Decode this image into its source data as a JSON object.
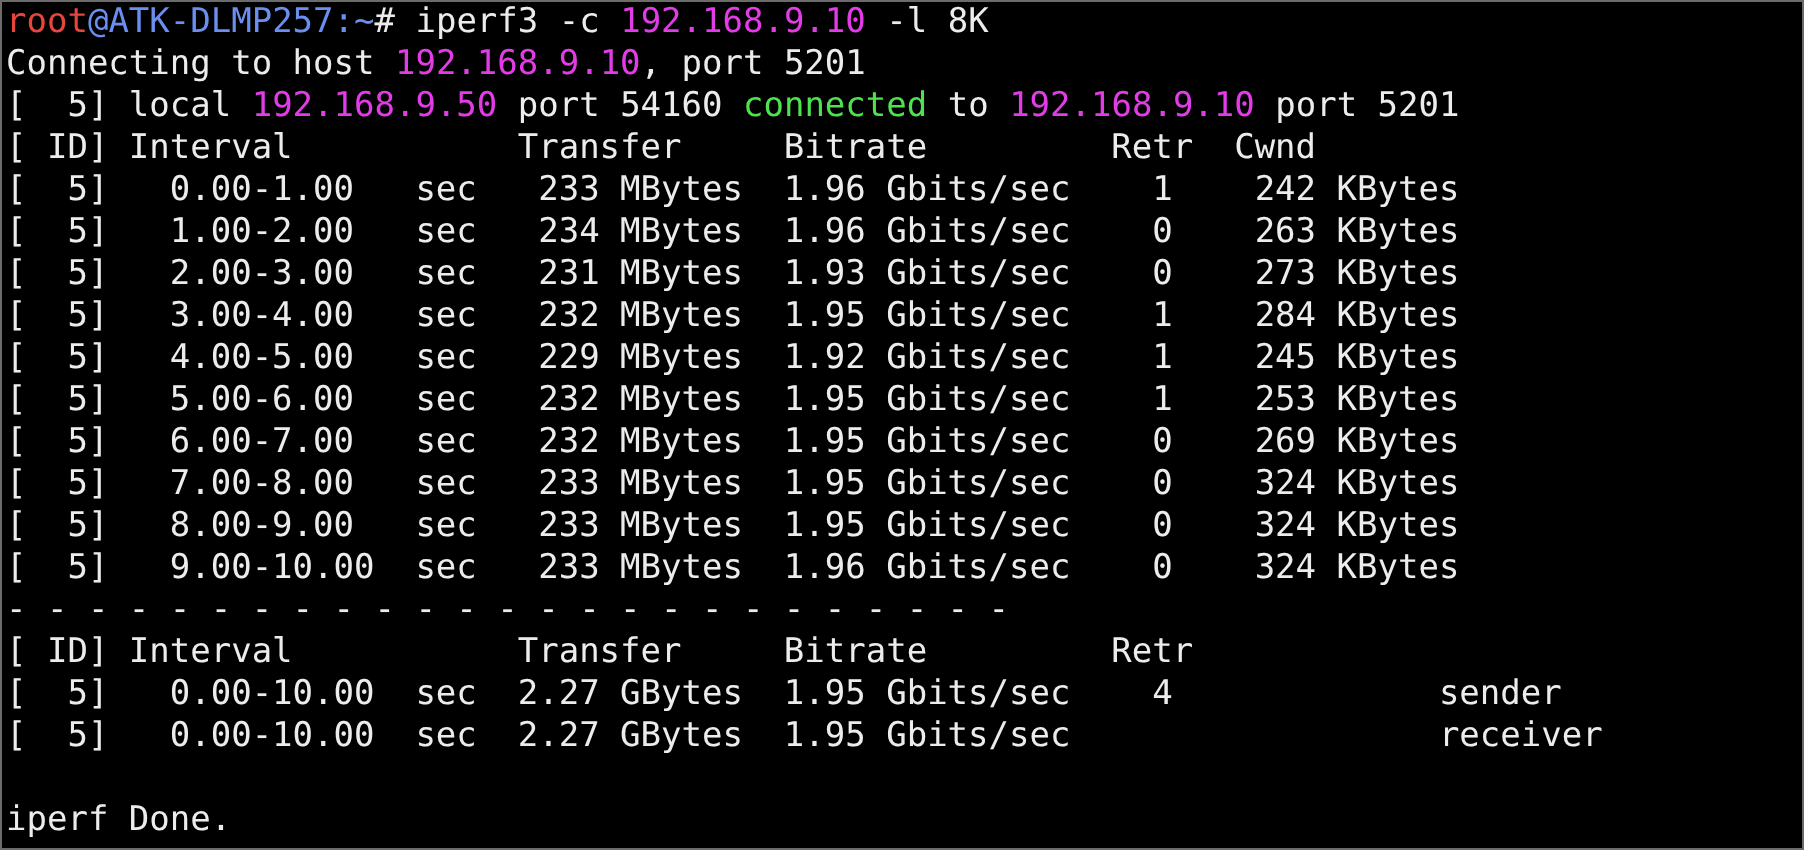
{
  "terminal": {
    "lines": [
      {
        "kind": "text",
        "segments": [
          {
            "text": "root",
            "color": "#e8453c"
          },
          {
            "text": "@ATK-DLMP257:~",
            "color": "#6a8ff0"
          },
          {
            "text": "# iperf3 -c ",
            "color": "#ececec"
          },
          {
            "text": "192.168.9.10",
            "color": "#e23ce6"
          },
          {
            "text": " -l 8K",
            "color": "#ececec"
          }
        ]
      },
      {
        "kind": "text",
        "segments": [
          {
            "text": "Connecting to host ",
            "color": "#ececec"
          },
          {
            "text": "192.168.9.10",
            "color": "#e23ce6"
          },
          {
            "text": ", port 5201",
            "color": "#ececec"
          }
        ]
      },
      {
        "kind": "text",
        "segments": [
          {
            "text": "[  5] local ",
            "color": "#ececec"
          },
          {
            "text": "192.168.9.50",
            "color": "#e23ce6"
          },
          {
            "text": " port 54160 ",
            "color": "#ececec"
          },
          {
            "text": "connected",
            "color": "#4ee24e"
          },
          {
            "text": " to ",
            "color": "#ececec"
          },
          {
            "text": "192.168.9.10",
            "color": "#e23ce6"
          },
          {
            "text": " port 5201",
            "color": "#ececec"
          }
        ]
      },
      {
        "kind": "text",
        "segments": [
          {
            "text": "[ ID] Interval           Transfer     Bitrate         Retr  Cwnd",
            "color": "#ececec"
          }
        ]
      },
      {
        "kind": "text",
        "segments": [
          {
            "text": "[  5]   0.00-1.00   sec   233 MBytes  1.96 Gbits/sec    1    242 KBytes",
            "color": "#ececec"
          }
        ]
      },
      {
        "kind": "text",
        "segments": [
          {
            "text": "[  5]   1.00-2.00   sec   234 MBytes  1.96 Gbits/sec    0    263 KBytes",
            "color": "#ececec"
          }
        ]
      },
      {
        "kind": "text",
        "segments": [
          {
            "text": "[  5]   2.00-3.00   sec   231 MBytes  1.93 Gbits/sec    0    273 KBytes",
            "color": "#ececec"
          }
        ]
      },
      {
        "kind": "text",
        "segments": [
          {
            "text": "[  5]   3.00-4.00   sec   232 MBytes  1.95 Gbits/sec    1    284 KBytes",
            "color": "#ececec"
          }
        ]
      },
      {
        "kind": "text",
        "segments": [
          {
            "text": "[  5]   4.00-5.00   sec   229 MBytes  1.92 Gbits/sec    1    245 KBytes",
            "color": "#ececec"
          }
        ]
      },
      {
        "kind": "text",
        "segments": [
          {
            "text": "[  5]   5.00-6.00   sec   232 MBytes  1.95 Gbits/sec    1    253 KBytes",
            "color": "#ececec"
          }
        ]
      },
      {
        "kind": "text",
        "segments": [
          {
            "text": "[  5]   6.00-7.00   sec   232 MBytes  1.95 Gbits/sec    0    269 KBytes",
            "color": "#ececec"
          }
        ]
      },
      {
        "kind": "text",
        "segments": [
          {
            "text": "[  5]   7.00-8.00   sec   233 MBytes  1.95 Gbits/sec    0    324 KBytes",
            "color": "#ececec"
          }
        ]
      },
      {
        "kind": "text",
        "segments": [
          {
            "text": "[  5]   8.00-9.00   sec   233 MBytes  1.95 Gbits/sec    0    324 KBytes",
            "color": "#ececec"
          }
        ]
      },
      {
        "kind": "text",
        "segments": [
          {
            "text": "[  5]   9.00-10.00  sec   233 MBytes  1.96 Gbits/sec    0    324 KBytes",
            "color": "#ececec"
          }
        ]
      },
      {
        "kind": "text",
        "segments": [
          {
            "text": "- - - - - - - - - - - - - - - - - - - - - - - - -",
            "color": "#ececec"
          }
        ]
      },
      {
        "kind": "text",
        "segments": [
          {
            "text": "[ ID] Interval           Transfer     Bitrate         Retr",
            "color": "#ececec"
          }
        ]
      },
      {
        "kind": "text",
        "segments": [
          {
            "text": "[  5]   0.00-10.00  sec  2.27 GBytes  1.95 Gbits/sec    4             sender",
            "color": "#ececec"
          }
        ]
      },
      {
        "kind": "text",
        "segments": [
          {
            "text": "[  5]   0.00-10.00  sec  2.27 GBytes  1.95 Gbits/sec                  receiver",
            "color": "#ececec"
          }
        ]
      },
      {
        "kind": "blank"
      },
      {
        "kind": "text",
        "segments": [
          {
            "text": "iperf Done.",
            "color": "#ececec"
          }
        ]
      }
    ]
  }
}
